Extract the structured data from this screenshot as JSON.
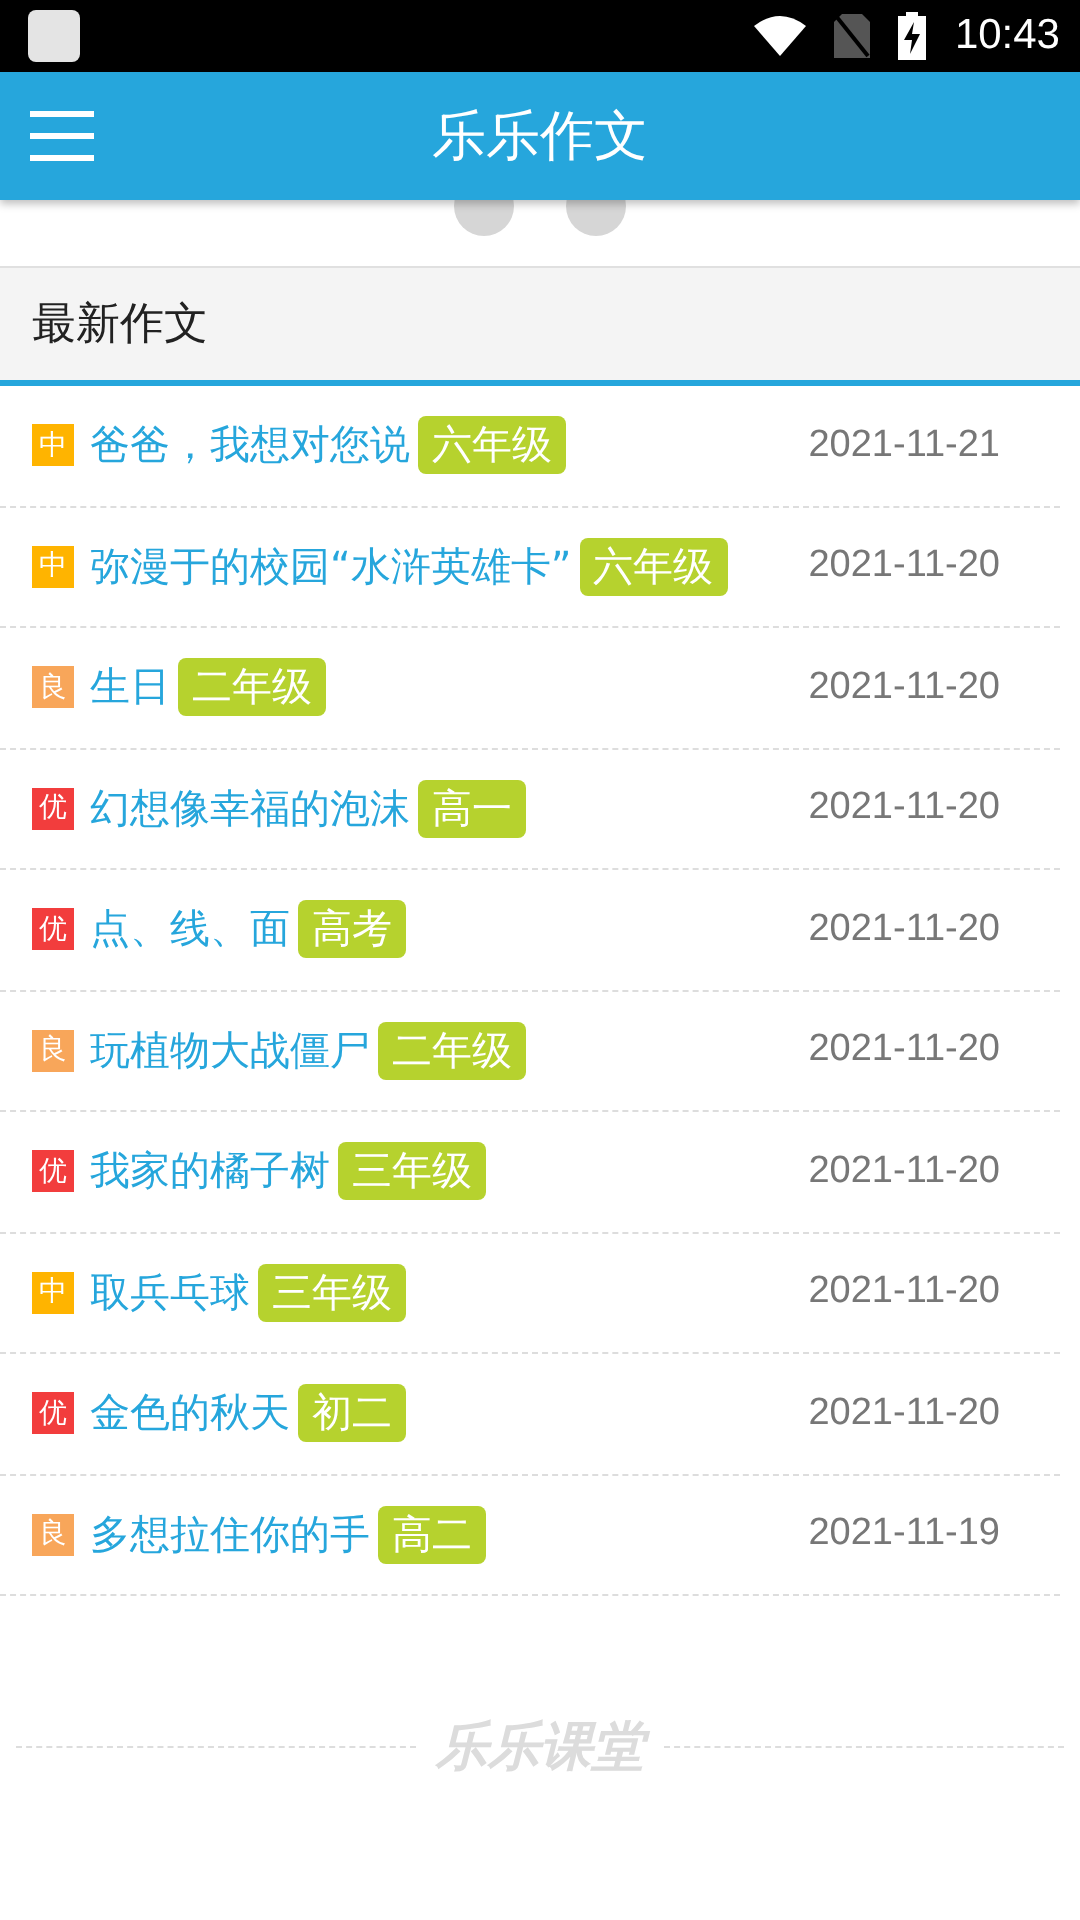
{
  "status_bar": {
    "time": "10:43"
  },
  "app_bar": {
    "title": "乐乐作文"
  },
  "section": {
    "title": "最新作文"
  },
  "essays": [
    {
      "rating": "中",
      "color": "#ffb400",
      "title": "爸爸，我想对您说",
      "grade": "六年级",
      "date": "2021-11-21"
    },
    {
      "rating": "中",
      "color": "#ffb400",
      "title": "弥漫于的校园“水浒英雄卡”",
      "grade": "六年级",
      "date": "2021-11-20"
    },
    {
      "rating": "良",
      "color": "#f8a65a",
      "title": "生日",
      "grade": "二年级",
      "date": "2021-11-20"
    },
    {
      "rating": "优",
      "color": "#f23d3d",
      "title": "幻想像幸福的泡沫",
      "grade": "高一",
      "date": "2021-11-20"
    },
    {
      "rating": "优",
      "color": "#f23d3d",
      "title": "点、线、面",
      "grade": "高考",
      "date": "2021-11-20"
    },
    {
      "rating": "良",
      "color": "#f8a65a",
      "title": "玩植物大战僵尸",
      "grade": "二年级",
      "date": "2021-11-20"
    },
    {
      "rating": "优",
      "color": "#f23d3d",
      "title": "我家的橘子树",
      "grade": "三年级",
      "date": "2021-11-20"
    },
    {
      "rating": "中",
      "color": "#ffb400",
      "title": "取兵乓球",
      "grade": "三年级",
      "date": "2021-11-20"
    },
    {
      "rating": "优",
      "color": "#f23d3d",
      "title": "金色的秋天",
      "grade": "初二",
      "date": "2021-11-20"
    },
    {
      "rating": "良",
      "color": "#f8a65a",
      "title": "多想拉住你的手",
      "grade": "高二",
      "date": "2021-11-19"
    }
  ],
  "footer": {
    "logo": "乐乐课堂"
  }
}
